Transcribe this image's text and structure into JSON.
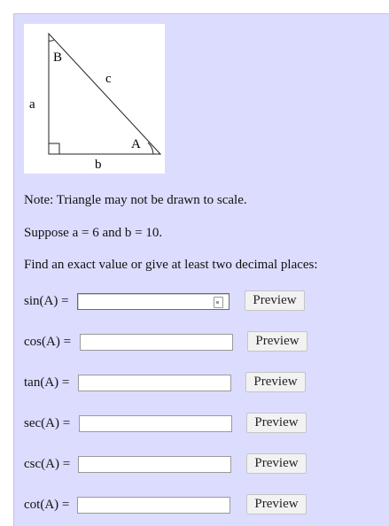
{
  "figure": {
    "vertex_B": "B",
    "vertex_A": "A",
    "side_a": "a",
    "side_b": "b",
    "side_c": "c"
  },
  "note": "Note: Triangle may not be drawn to scale.",
  "given": "Suppose a = 6 and b = 10.",
  "instruction": "Find an exact value or give at least two decimal places:",
  "rows": [
    {
      "label": "sin(A) =",
      "value": "",
      "button": "Preview"
    },
    {
      "label": "cos(A) =",
      "value": "",
      "button": "Preview"
    },
    {
      "label": "tan(A) =",
      "value": "",
      "button": "Preview"
    },
    {
      "label": "sec(A) =",
      "value": "",
      "button": "Preview"
    },
    {
      "label": "csc(A) =",
      "value": "",
      "button": "Preview"
    },
    {
      "label": "cot(A) =",
      "value": "",
      "button": "Preview"
    }
  ]
}
